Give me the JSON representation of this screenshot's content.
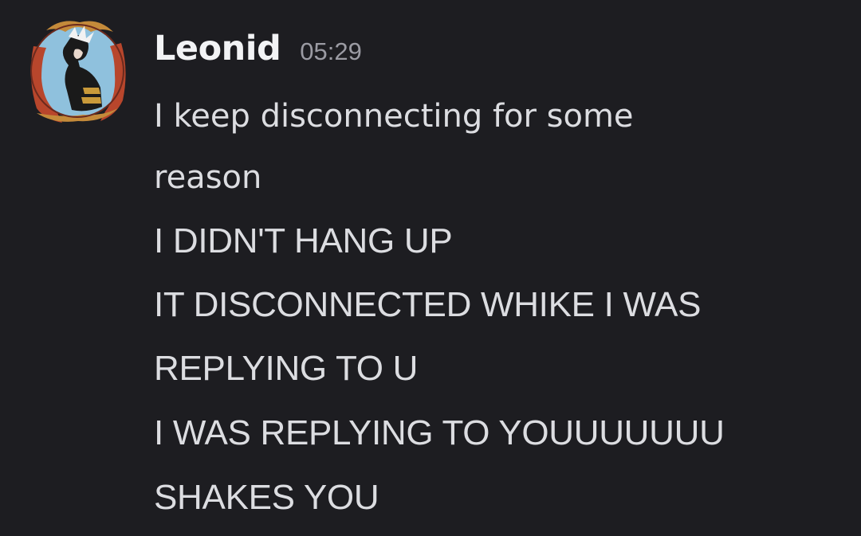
{
  "message": {
    "author": "Leonid",
    "timestamp": "05:29",
    "lines": [
      "I keep disconnecting for some",
      "reason",
      "I DIDN'T HANG UP",
      "IT DISCONNECTED WHIKE I WAS REPLYING TO U",
      "I WAS REPLYING TO YOUUUUUUU",
      "SHAKES YOU"
    ]
  },
  "colors": {
    "background": "#1d1d21",
    "username": "#f2f3f5",
    "timestamp": "#9b9ba3",
    "text": "#dcdde1",
    "avatar_bg": "#8fc1dd",
    "avatar_frame": "#b8462c"
  },
  "icons": {
    "avatar": "user-avatar"
  }
}
